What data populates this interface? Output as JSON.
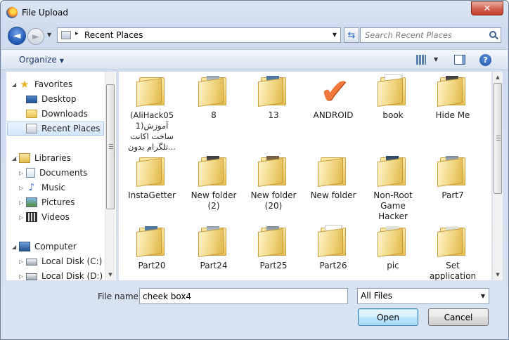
{
  "window": {
    "title": "File Upload",
    "close_symbol": "✕"
  },
  "nav": {
    "back_symbol": "◄",
    "forward_symbol": "►",
    "dropdown_symbol": "▼",
    "breadcrumb_chevron": "▸",
    "address": "Recent Places",
    "address_dropdown_symbol": "▼",
    "refresh_symbol": "⇆",
    "search_placeholder": "Search Recent Places"
  },
  "toolbar": {
    "organize_label": "Organize",
    "organize_arrow": "▼",
    "views_arrow": "▼",
    "help_symbol": "?"
  },
  "sidebar": {
    "favorites": {
      "label": "Favorites",
      "star": "★"
    },
    "desktop": "Desktop",
    "downloads": "Downloads",
    "recent_places": "Recent Places",
    "libraries": "Libraries",
    "documents": "Documents",
    "music": "Music",
    "music_note": "♪",
    "pictures": "Pictures",
    "videos": "Videos",
    "computer": "Computer",
    "local_disk_c": "Local Disk (C:)",
    "local_disk_d": "Local Disk (D:)",
    "expand_open": "◢",
    "expand_closed": "▷"
  },
  "files": [
    {
      "label": "(AliHack05\nآموزش(1\nساخت اکانت\nتلگرام بدون..."
    },
    {
      "label": "8"
    },
    {
      "label": "13"
    },
    {
      "label": "ANDROID",
      "check": "✔"
    },
    {
      "label": "book"
    },
    {
      "label": "Hide Me"
    },
    {
      "label": "InstaGetter"
    },
    {
      "label": "New folder\n(2)"
    },
    {
      "label": "New folder\n(20)"
    },
    {
      "label": "New folder"
    },
    {
      "label": "Non-Root\nGame\nHacker"
    },
    {
      "label": "Part7"
    },
    {
      "label": "Part20"
    },
    {
      "label": "Part24"
    },
    {
      "label": "Part25"
    },
    {
      "label": "Part26"
    },
    {
      "label": "pic"
    },
    {
      "label": "Set\napplication"
    }
  ],
  "footer": {
    "filename_label": "File name:",
    "filename_value": "cheek box4",
    "filter_value": "All Files",
    "filter_arrow": "▼",
    "open_label": "Open",
    "cancel_label": "Cancel"
  },
  "scroll": {
    "up": "▲",
    "down": "▼"
  }
}
